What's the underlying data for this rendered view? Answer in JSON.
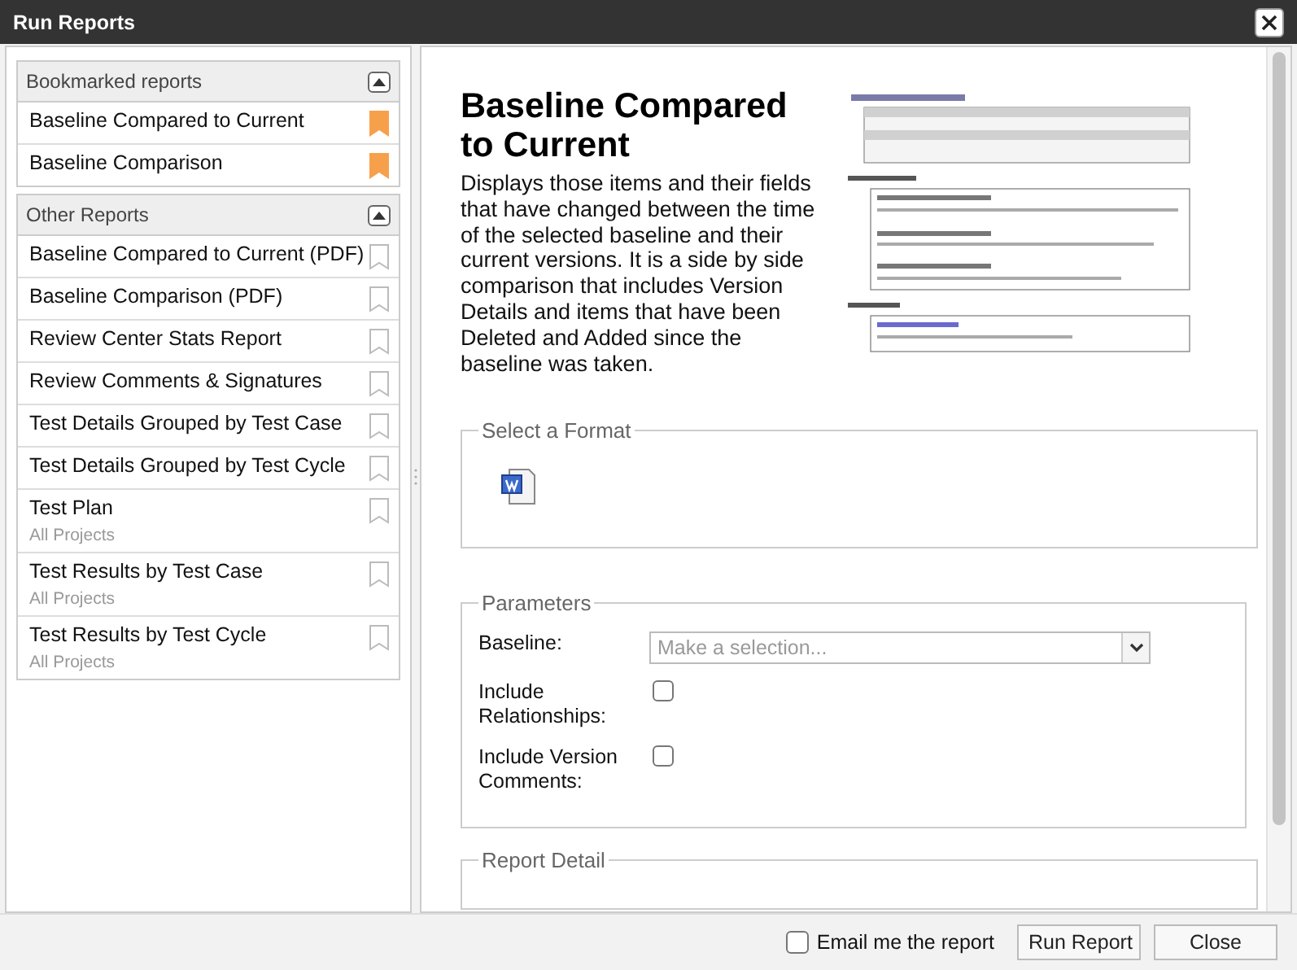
{
  "window": {
    "title": "Run Reports"
  },
  "sidebar": {
    "groups": [
      {
        "title": "Bookmarked reports",
        "expanded": true,
        "items": [
          {
            "label": "Baseline Compared to Current",
            "bookmarked": true
          },
          {
            "label": "Baseline Comparison",
            "bookmarked": true
          }
        ]
      },
      {
        "title": "Other Reports",
        "expanded": true,
        "items": [
          {
            "label": "Baseline Compared to Current (PDF)",
            "bookmarked": false
          },
          {
            "label": "Baseline Comparison (PDF)",
            "bookmarked": false
          },
          {
            "label": "Review Center Stats Report",
            "bookmarked": false
          },
          {
            "label": "Review Comments & Signatures",
            "bookmarked": false
          },
          {
            "label": "Test Details Grouped by Test Case",
            "bookmarked": false
          },
          {
            "label": "Test Details Grouped by Test Cycle",
            "bookmarked": false
          },
          {
            "label": "Test Plan",
            "subtitle": "All Projects",
            "bookmarked": false
          },
          {
            "label": "Test Results by Test Case",
            "subtitle": "All Projects",
            "bookmarked": false
          },
          {
            "label": "Test Results by Test Cycle",
            "subtitle": "All Projects",
            "bookmarked": false
          }
        ]
      }
    ]
  },
  "report": {
    "title": "Baseline Compared to Current",
    "description": "Displays those items and their fields that have changed between the time of the selected baseline and their current versions. It is a side by side comparison that includes Version Details and items that have been Deleted and Added since the baseline was taken."
  },
  "format": {
    "legend": "Select a Format"
  },
  "parameters": {
    "legend": "Parameters",
    "fields": [
      {
        "kind": "select",
        "label": "Baseline:",
        "placeholder": "Make a selection..."
      },
      {
        "kind": "checkbox",
        "label": "Include Relationships:",
        "checked": false
      },
      {
        "kind": "checkbox",
        "label": "Include Version Comments:",
        "checked": false
      }
    ]
  },
  "report_detail": {
    "legend": "Report Detail"
  },
  "footer": {
    "email": {
      "label": "Email me the report",
      "checked": false
    },
    "buttons": [
      "Run Report",
      "Close"
    ]
  }
}
